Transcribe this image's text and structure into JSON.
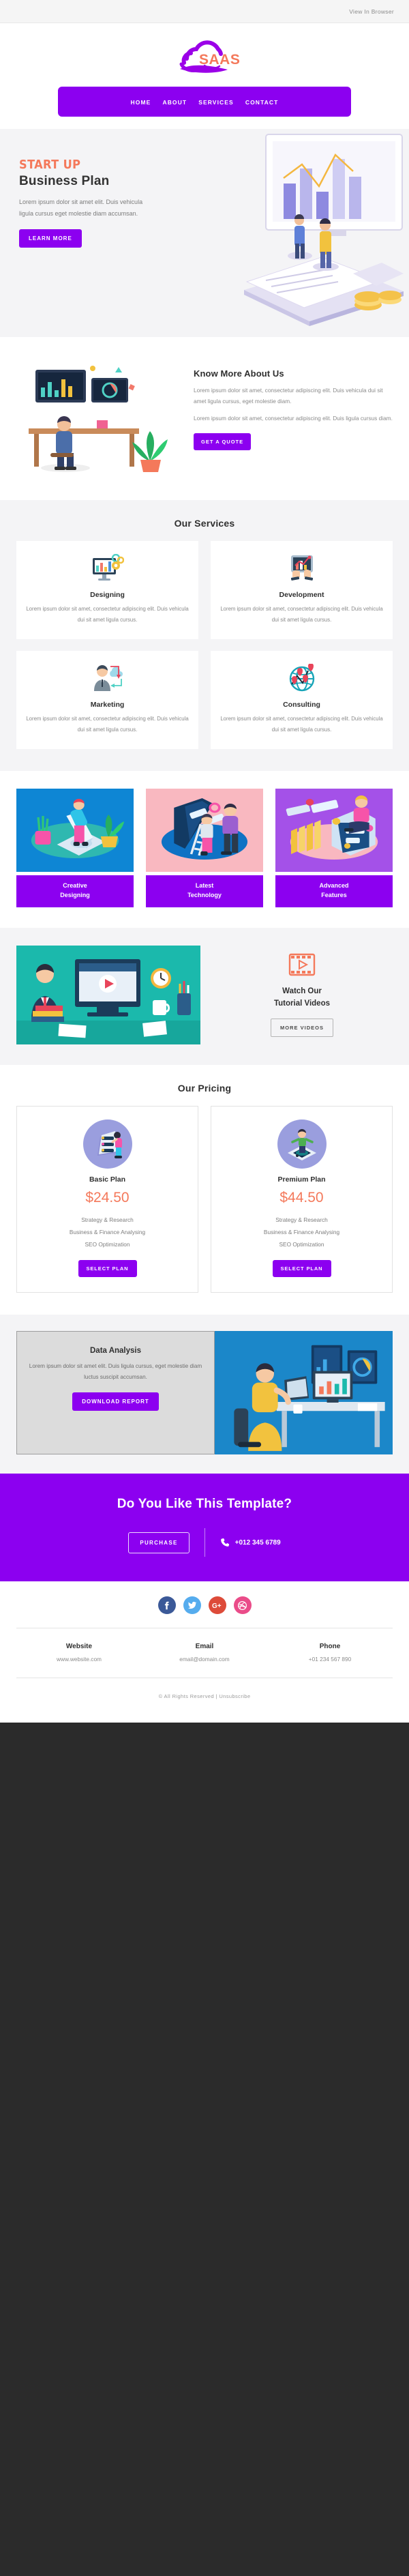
{
  "preheader": {
    "view_in_browser": "View In Browser"
  },
  "brand": {
    "name": "SAAS",
    "logo_purple": "#9b00e8",
    "logo_orange": "#f4795b"
  },
  "colors": {
    "primary": "#8c00f0",
    "accent_orange": "#f4795b",
    "bg_light": "#f4f4f6"
  },
  "nav": {
    "items": [
      {
        "label": "HOME"
      },
      {
        "label": "ABOUT"
      },
      {
        "label": "SERVICES"
      },
      {
        "label": "CONTACT"
      }
    ]
  },
  "hero": {
    "eyebrow": "START UP",
    "title": "Business Plan",
    "description": "Lorem ipsum dolor sit amet elit. Duis vehicula ligula cursus eget molestie diam accumsan.",
    "button": "LEARN MORE"
  },
  "about": {
    "title": "Know More About Us",
    "paragraph1": "Lorem ipsum dolor sit amet, consectetur adipiscing elit. Duis vehicula dui sit amet ligula cursus, eget molestie diam.",
    "paragraph2": "Lorem ipsum dolor sit amet, consectetur adipiscing elit. Duis ligula cursus diam.",
    "button": "GET A QUOTE"
  },
  "services": {
    "title": "Our Services",
    "cards": [
      {
        "name": "Designing",
        "desc": "Lorem ipsum dolor sit amet, consectetur adipiscing elit. Duis vehicula dui sit amet ligula cursus.",
        "icon": "monitor-chart-gears-icon"
      },
      {
        "name": "Development",
        "desc": "Lorem ipsum dolor sit amet, consectetur adipiscing elit. Duis vehicula dui sit amet ligula cursus.",
        "icon": "tablet-growth-chart-icon"
      },
      {
        "name": "Marketing",
        "desc": "Lorem ipsum dolor sit amet, consectetur adipiscing elit. Duis vehicula dui sit amet ligula cursus.",
        "icon": "businessman-cloud-icon"
      },
      {
        "name": "Consulting",
        "desc": "Lorem ipsum dolor sit amet, consectetur adipiscing elit. Duis vehicula dui sit amet ligula cursus.",
        "icon": "globe-location-pins-icon"
      }
    ]
  },
  "features": {
    "cards": [
      {
        "line1": "Creative",
        "line2": "Designing",
        "bg": "#0e86d4"
      },
      {
        "line1": "Latest",
        "line2": "Technology",
        "bg": "#f9b8c0"
      },
      {
        "line1": "Advanced",
        "line2": "Features",
        "bg": "#a451e8"
      }
    ]
  },
  "video": {
    "title_line1": "Watch Our",
    "title_line2": "Tutorial Videos",
    "button": "MORE VIDEOS",
    "icon": "film-play-icon"
  },
  "pricing": {
    "title": "Our Pricing",
    "plans": [
      {
        "name": "Basic Plan",
        "price": "$24.50",
        "features": [
          "Strategy & Research",
          "Business & Finance Analysing",
          "SEO Optimization"
        ],
        "button": "SELECT PLAN"
      },
      {
        "name": "Premium Plan",
        "price": "$44.50",
        "features": [
          "Strategy & Research",
          "Business & Finance Analysing",
          "SEO Optimization"
        ],
        "button": "SELECT PLAN"
      }
    ]
  },
  "analysis": {
    "title": "Data Analysis",
    "description": "Lorem ipsum dolor sit amet elit. Duis ligula cursus, eget molestie diam luctus suscipit accumsan.",
    "button": "DOWNLOAD REPORT"
  },
  "cta": {
    "title": "Do You Like This Template?",
    "button": "PURCHASE",
    "phone": "+012 345 6789",
    "phone_icon": "phone-icon"
  },
  "footer": {
    "social": [
      {
        "name": "facebook-icon",
        "color": "#3b5998"
      },
      {
        "name": "twitter-icon",
        "color": "#55acee"
      },
      {
        "name": "google-plus-icon",
        "color": "#dd4b39"
      },
      {
        "name": "dribbble-icon",
        "color": "#ea4c89"
      }
    ],
    "contacts": [
      {
        "label": "Website",
        "value": "www.website.com"
      },
      {
        "label": "Email",
        "value": "email@domain.com"
      },
      {
        "label": "Phone",
        "value": "+01 234 567 890"
      }
    ],
    "copyright": "© All Rights Reserved | Unsubscribe"
  }
}
